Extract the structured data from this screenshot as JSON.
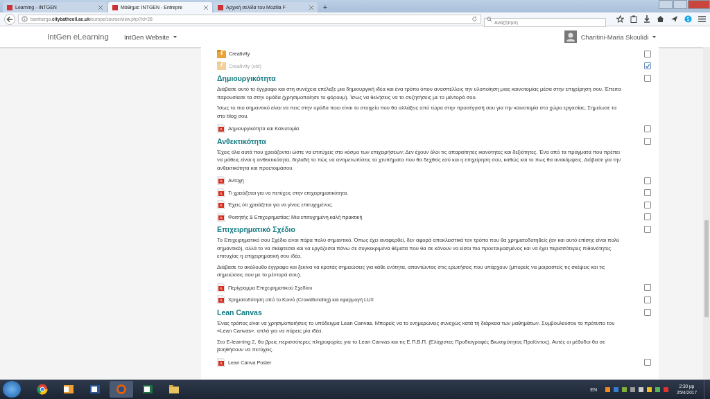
{
  "browser": {
    "tabs": [
      {
        "label": "Learning - INTGEN",
        "selected": false
      },
      {
        "label": "Μάθημα: INTGEN - Entrepre",
        "selected": true
      },
      {
        "label": "Αρχική σελίδα του Mozilla F",
        "selected": false
      }
    ],
    "new_tab": "+",
    "url": {
      "host": "bamberga.",
      "domain": "citybathcoll.ac.uk",
      "path": "/europe/course/view.php?id=28"
    },
    "search": {
      "placeholder": "Αναζήτηση"
    }
  },
  "navbar": {
    "brand": "IntGen eLearning",
    "menu": "IntGen Website",
    "user": "Charitini-Maria Skoulidi"
  },
  "course": [
    {
      "kind": "folder",
      "label": "Creativity",
      "dimmed": false,
      "checked": false
    },
    {
      "kind": "folder",
      "label": "Creativity (old)",
      "dimmed": true,
      "checked": true
    },
    {
      "kind": "heading",
      "label": "Δημιουργικότητα",
      "checked": false
    },
    {
      "kind": "paragraph",
      "text": "Διάβασε αυτό το έγγραφο και στη συνέχεια επέλεξε μια δημιουργική ιδέα και ένα τρόπο όπου ανασπέλλεις την υλοποίηση μιας καινοτομίας μέσα στην επιχείρηση σου. Έπειτα παρουσίασε τα στην ομάδα (χρησιμοποίησε το φόρουμ). Ίσως να θελήσεις να το συζητήσεις με το μέντορά σου."
    },
    {
      "kind": "paragraph",
      "text": "Ίσως το πιο σημαντικό είναι να πεις στην ομάδα ποιο είναι το στοιχείο που θα αλλάξεις από τώρα στην προσέγγισή σου για την καινοτομία στο χώρο εργασίας. Σημείωσε τα στο blog σου."
    },
    {
      "kind": "pdf",
      "label": "Δημιουργικότητα και Καινοτομία",
      "dimmed": false,
      "checked": false
    },
    {
      "kind": "heading",
      "label": "Ανθεκτικότητα",
      "checked": false
    },
    {
      "kind": "paragraph",
      "text": "Έχεις όλα αυτά που χρειάζονται ώστε να επιτύχεις στο κόσμο των επιχειρήσεων; Δεν έχουν όλοι τις απαραίτητες ικανότητες και δεξιότητες. Ένα από τα πράγματα που πρέπει να μάθεις είναι η ανθεκτικότητα, δηλαδή το πώς να αντιμετωπίσεις τα χτυπήματα που θα δεχθείς εσύ και η επιχείρηση σου, καθώς και το πως θα ανακάμψεις. Διάβασε για την ανθεκτικότητα και προετοιμάσου."
    },
    {
      "kind": "pdf",
      "label": "Αντοχή",
      "dimmed": false,
      "checked": false
    },
    {
      "kind": "pdf",
      "label": "Τι χρειάζεται για να πετύχεις στην επιχειρηματικότητα.",
      "dimmed": false,
      "checked": false
    },
    {
      "kind": "pdf",
      "label": "Έχεις ότι χρειάζεται για να γίνεις επιτυχημένος;",
      "dimmed": false,
      "checked": false
    },
    {
      "kind": "pdf",
      "label": "Φοιτητής & Επιχειρηματίας: Μια επιτυχημένη καλή πρακτική",
      "dimmed": false,
      "checked": false
    },
    {
      "kind": "heading",
      "label": "Επιχειρηματικό Σχέδιο",
      "checked": false
    },
    {
      "kind": "paragraph",
      "text": "Το Επιχειρηματικό σου Σχέδιο είναι πάρα πολύ σημαντικό. Όπως έχει αναφερθεί, δεν αφορά αποκλειστικά τον τρόπο που θα χρηματοδοτηθείς (αν και αυτό επίσης είναι πολύ σημαντικό), αλλά το να σκέφτεσαι και να εργάζεσαι πάνω σε συγκεκριμένα θέματα που θα σε κάνουν να είσαι πιο προετοιμασμένος και να έχει περισσότερες πιθανότητες επιτυχίας η επιχειρηματική σου ιδέα."
    },
    {
      "kind": "paragraph",
      "text": "Διάβασε το ακόλουθο έγγραφο και ξεκίνα να κρατάς σημειώσεις για κάθε ενότητα, απαντώντας στις ερωτήσεις που υπάρχουν (μπορείς να μοιραστείς τις σκέψεις και τις σημειώσεις σου με το μέντορά σου)."
    },
    {
      "kind": "pdf",
      "label": "Περίγραμμα Επιχειρηματικού Σχεδίου",
      "dimmed": false,
      "checked": false
    },
    {
      "kind": "pdf",
      "label": "Χρηματοδότηση από το Κοινό (Crowdfunding) και εφαρμογή LUX",
      "dimmed": false,
      "checked": false
    },
    {
      "kind": "heading",
      "label": "Lean Canvas",
      "checked": false
    },
    {
      "kind": "paragraph",
      "text": "Ένας τρόπος είναι να χρησιμοποιήσεις το υπόδειγμα Lean Canvas. Μπορείς να το ενημερώνεις συνεχώς κατά τη διάρκεια των μαθημάτων. Συμβουλεύσου το πρότυπο του «Lean Canvas», απλά για να πάρεις μία ιδέα."
    },
    {
      "kind": "paragraph",
      "text": "Στο E-learning 2, θα βρεις περισσότερες πληροφορίες για το Lean Canvas και τις Ε.Π.Β.Π. (Ελάχιστες Προδιαγραφές Βιωσιμότητας Προϊόντος). Αυτές οι μέθοδοι θα σε βοηθήσουν να πετύχεις."
    },
    {
      "kind": "pdf",
      "label": "Lean Canva Poster",
      "dimmed": false,
      "checked": false
    }
  ],
  "taskbar": {
    "language": "EN",
    "time": "2:30 μμ",
    "date": "25/4/2017"
  }
}
